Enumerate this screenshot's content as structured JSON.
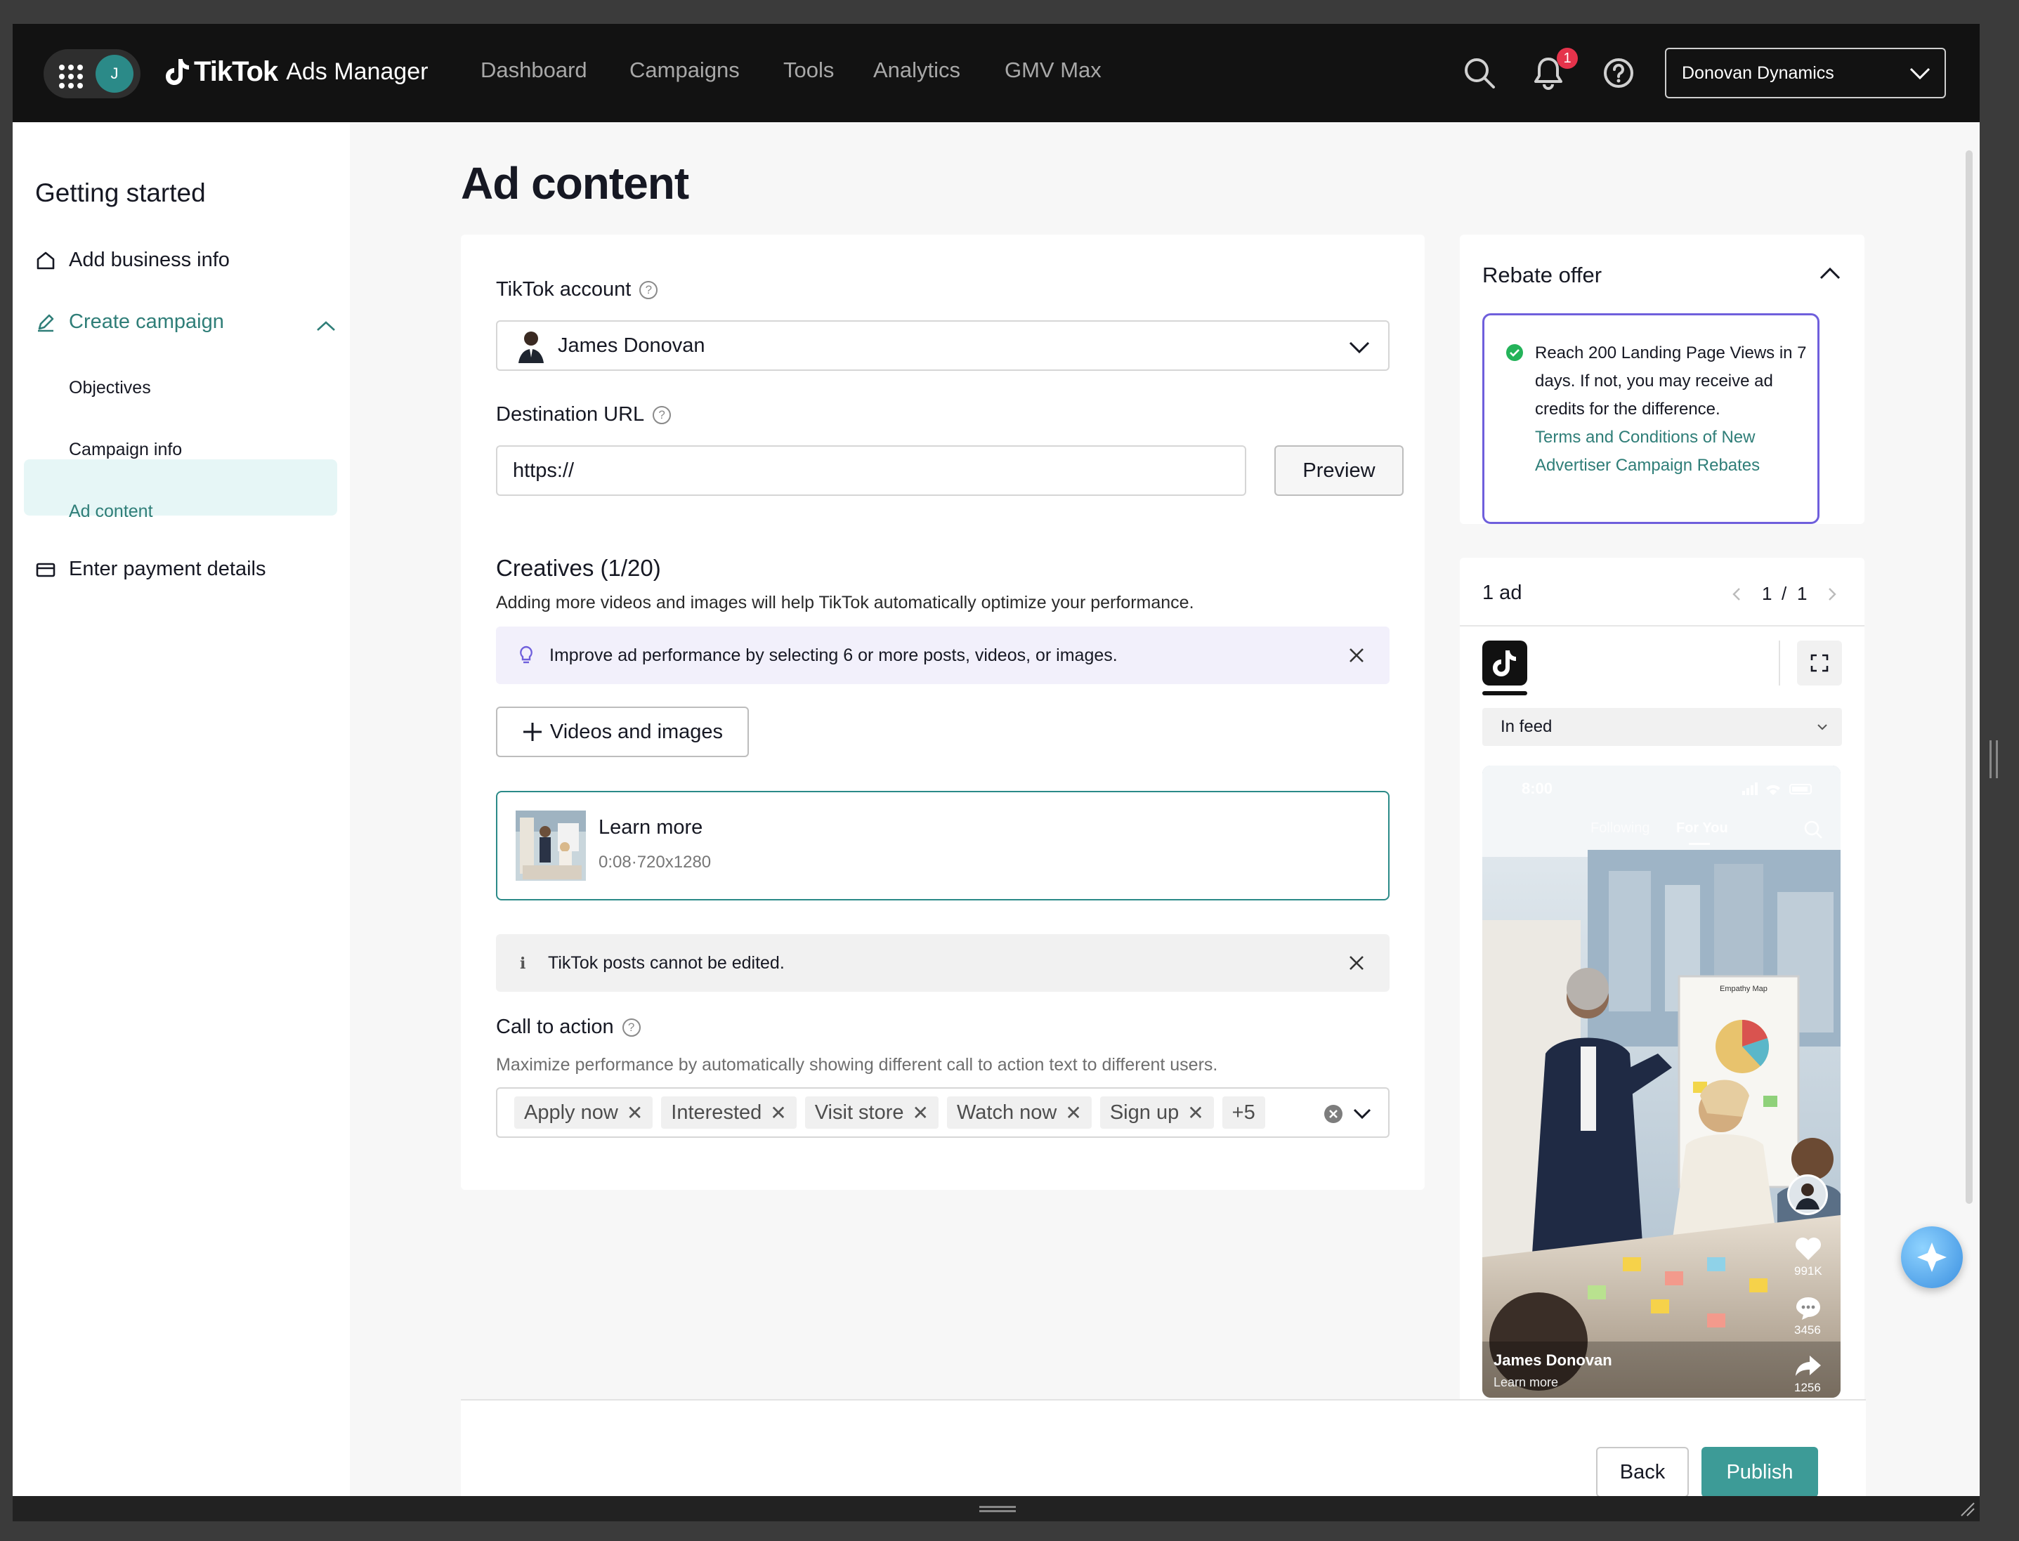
{
  "topnav": {
    "avatar_initial": "J",
    "logo_brand": "TikTok",
    "logo_product": "Ads Manager",
    "nav_items": [
      "Dashboard",
      "Campaigns",
      "Tools",
      "Analytics",
      "GMV Max"
    ],
    "notification_count": "1",
    "account_name": "Donovan Dynamics",
    "icons": [
      "apps-grid-icon",
      "search-icon",
      "bell-icon",
      "help-icon",
      "chevron-down-icon"
    ]
  },
  "sidebar": {
    "title": "Getting started",
    "items": [
      {
        "label": "Add business info",
        "icon": "home-icon"
      },
      {
        "label": "Create campaign",
        "icon": "pencil-icon"
      },
      {
        "label": "Enter payment details",
        "icon": "card-icon"
      }
    ],
    "subitems": [
      "Objectives",
      "Campaign info",
      "Ad content"
    ],
    "active_subitem": "Ad content"
  },
  "main": {
    "title": "Ad content",
    "tiktok_account": {
      "label": "TikTok account",
      "value": "James Donovan"
    },
    "destination_url": {
      "label": "Destination URL",
      "value": "https://",
      "preview_label": "Preview"
    },
    "creatives": {
      "title": "Creatives (1/20)",
      "description": "Adding more videos and images will help TikTok automatically optimize your performance.",
      "tip": "Improve ad performance by selecting 6 or more posts, videos, or images.",
      "add_button": "Videos and images",
      "item": {
        "title": "Learn more",
        "meta": "0:08·720x1280"
      },
      "notice": "TikTok posts cannot be edited."
    },
    "cta": {
      "label": "Call to action",
      "description": "Maximize performance by automatically showing different call to action text to different users.",
      "chips": [
        "Apply now",
        "Interested",
        "Visit store",
        "Watch now",
        "Sign up"
      ],
      "more": "+5"
    }
  },
  "rebate": {
    "title": "Rebate offer",
    "text": "Reach 200 Landing Page Views in 7 days. If not, you may receive ad credits for the difference.",
    "link": "Terms and Conditions of New Advertiser Campaign Rebates"
  },
  "preview": {
    "count_label": "1 ad",
    "page_current": "1",
    "page_sep": "/",
    "page_total": "1",
    "placement": "In feed",
    "phone": {
      "time": "8:00",
      "tab_following": "Following",
      "tab_foryou": "For You",
      "likes": "991K",
      "comments": "3456",
      "shares": "1256",
      "username": "James Donovan",
      "cta": "Learn more",
      "board_text": "Empathy Map"
    }
  },
  "footer": {
    "back": "Back",
    "publish": "Publish"
  },
  "colors": {
    "accent": "#2b8a88",
    "link": "#2f7e78",
    "rebate_border": "#6f5fdc",
    "badge": "#e5334b",
    "publish": "#3d9b97"
  }
}
